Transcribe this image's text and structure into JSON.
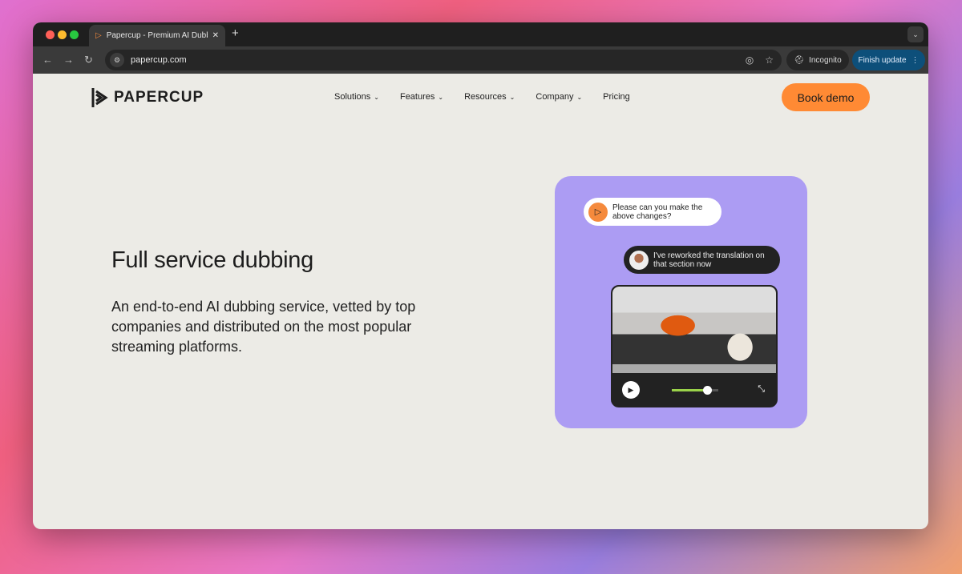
{
  "browser": {
    "tab_title": "Papercup - Premium AI Dubbing",
    "url": "papercup.com",
    "incognito_label": "Incognito",
    "finish_update_label": "Finish update"
  },
  "nav": {
    "brand": "PAPERCUP",
    "items": [
      {
        "label": "Solutions",
        "dropdown": true
      },
      {
        "label": "Features",
        "dropdown": true
      },
      {
        "label": "Resources",
        "dropdown": true
      },
      {
        "label": "Company",
        "dropdown": true
      },
      {
        "label": "Pricing",
        "dropdown": false
      }
    ],
    "cta": "Book demo"
  },
  "hero": {
    "title": "Full service dubbing",
    "subtitle": "An end-to-end AI dubbing service, vetted by top companies and distributed on the most popular streaming platforms."
  },
  "card": {
    "message1": "Please can you make the above changes?",
    "message2": "I've reworked the translation on that section now",
    "progress_percent": 75
  },
  "colors": {
    "accent": "#ff8a34",
    "card": "#ac9cf3",
    "progress": "#9ad24a",
    "update": "#0d4f7a"
  }
}
